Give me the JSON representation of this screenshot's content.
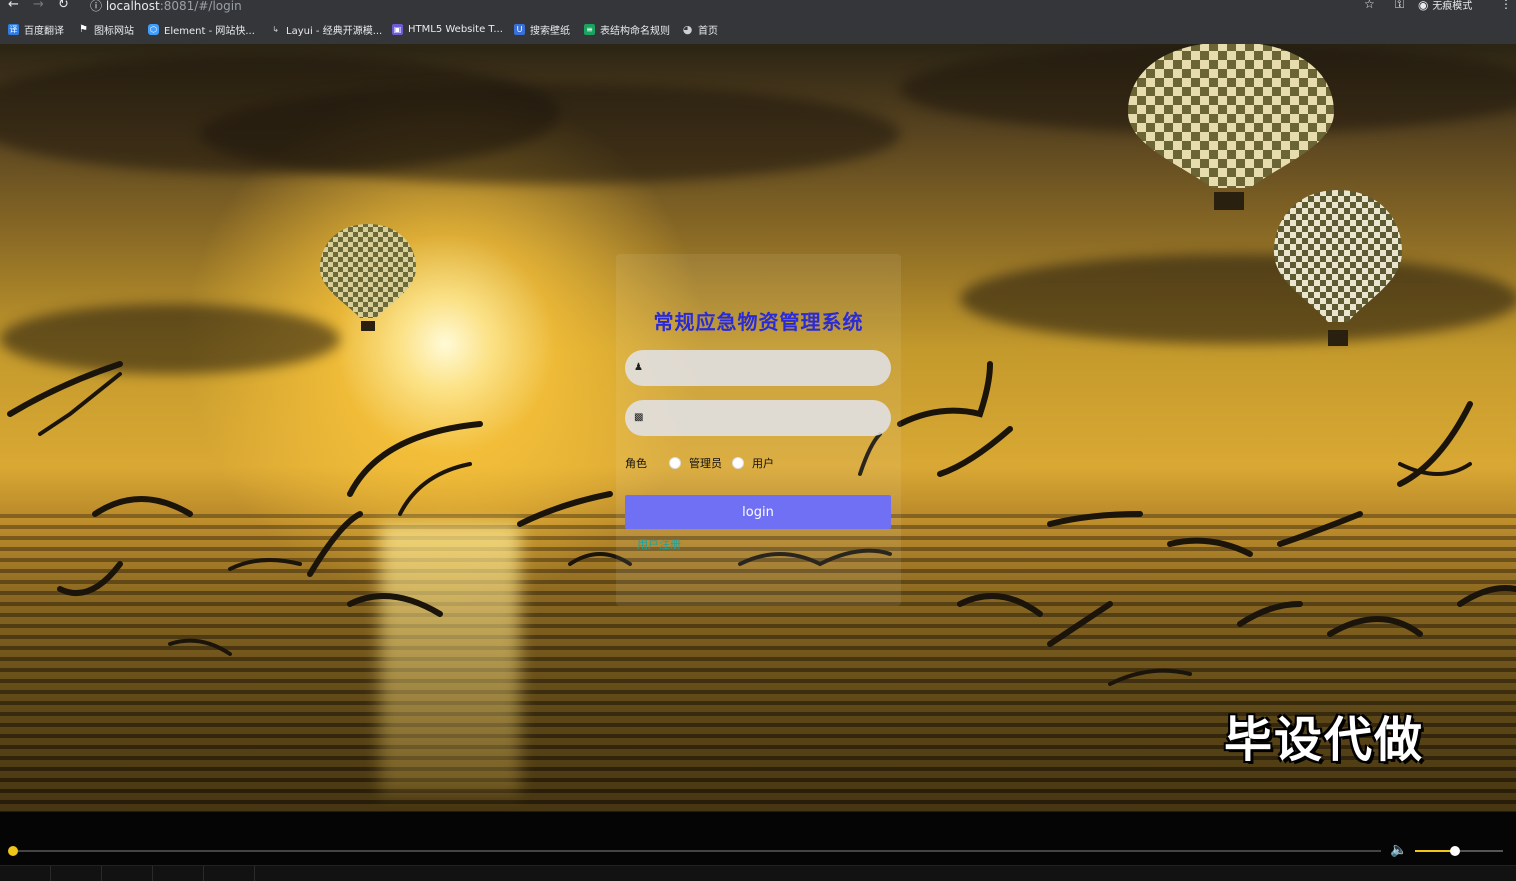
{
  "browser": {
    "url_host": "localhost",
    "url_path": ":8081/#/login",
    "profile_label": "无痕模式",
    "bookmarks": [
      {
        "label": "百度翻译",
        "icon": "translate-icon",
        "color": "#2f7de1"
      },
      {
        "label": "图标网站",
        "icon": "flag-icon",
        "color": "#ffffff"
      },
      {
        "label": "Element - 网站快...",
        "icon": "element-hexagon-icon",
        "color": "#409eff"
      },
      {
        "label": "Layui - 经典开源模...",
        "icon": "layui-icon",
        "color": "#cccccc"
      },
      {
        "label": "HTML5 Website T...",
        "icon": "html5-template-icon",
        "color": "#6b5bd6"
      },
      {
        "label": "搜索壁纸",
        "icon": "wallpaper-icon",
        "color": "#3b6fd8"
      },
      {
        "label": "表结构命名规则",
        "icon": "doc-icon",
        "color": "#1aa260"
      },
      {
        "label": "首页",
        "icon": "globe-icon",
        "color": "#cfcfcf"
      }
    ]
  },
  "login": {
    "title": "常规应急物资管理系统",
    "username_placeholder": "",
    "password_placeholder": "",
    "role_label": "角色",
    "roles": [
      "管理员",
      "用户"
    ],
    "button_label": "login",
    "register_link": "用户注册"
  },
  "watermark": "毕设代做",
  "player": {
    "progress": 0.0,
    "volume": 0.45
  },
  "colors": {
    "title": "#2b2bd6",
    "button": "#7070f5",
    "link": "#1ba39c",
    "player_accent": "#f0c419"
  }
}
